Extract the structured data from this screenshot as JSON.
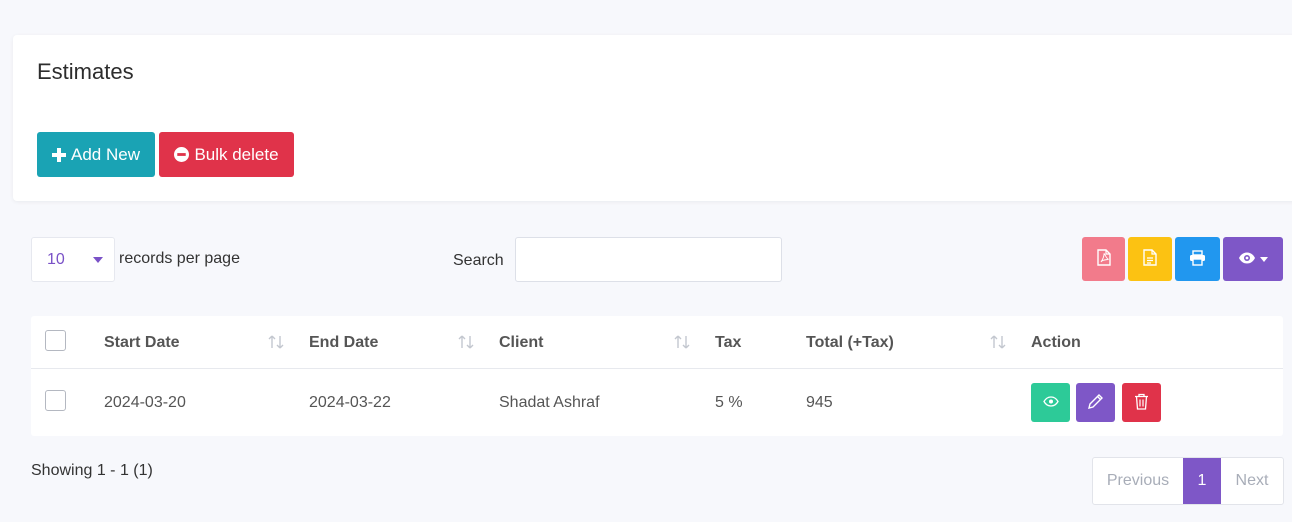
{
  "header": {
    "title": "Estimates",
    "add_new": "Add New",
    "bulk_delete": "Bulk delete"
  },
  "controls": {
    "per_page_value": "10",
    "per_page_label": "records per page",
    "search_label": "Search",
    "search_value": ""
  },
  "table": {
    "columns": [
      "Start Date",
      "End Date",
      "Client",
      "Tax",
      "Total (+Tax)",
      "Action"
    ],
    "rows": [
      {
        "start_date": "2024-03-20",
        "end_date": "2024-03-22",
        "client": "Shadat Ashraf",
        "tax": "5 %",
        "total": "945"
      }
    ]
  },
  "footer": {
    "showing": "Showing 1 - 1 (1)",
    "previous": "Previous",
    "page": "1",
    "next": "Next"
  },
  "colors": {
    "primary": "#7e57c7",
    "info": "#1aa3b4",
    "danger": "#e0334a",
    "success": "#2dca98",
    "warning": "#fcc212",
    "blue": "#2197ef",
    "pink": "#f27b8b"
  },
  "icons": {
    "add": "plus-icon",
    "bulk": "minus-circle-icon",
    "pdf": "file-pdf-icon",
    "csv": "file-text-icon",
    "print": "print-icon",
    "columns": "eye-icon",
    "sort": "sort-icon",
    "view": "eye-icon",
    "edit": "pencil-icon",
    "delete": "trash-icon"
  }
}
